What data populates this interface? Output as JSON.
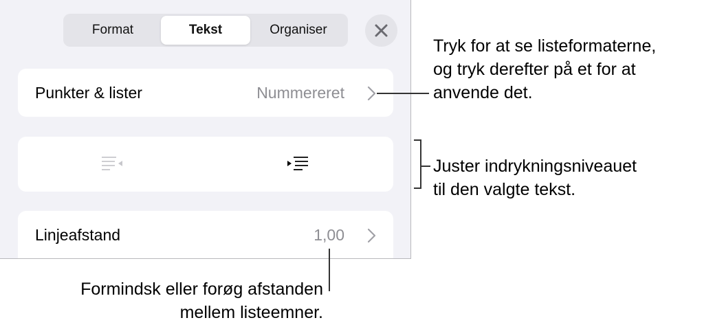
{
  "tabs": [
    {
      "label": "Format",
      "active": false
    },
    {
      "label": "Tekst",
      "active": true
    },
    {
      "label": "Organiser",
      "active": false
    }
  ],
  "close_icon": "close-icon",
  "rows": {
    "bullets": {
      "label": "Punkter & lister",
      "value": "Nummereret"
    },
    "indent": {
      "decrease_icon": "decrease-indent-icon",
      "increase_icon": "increase-indent-icon",
      "decrease_enabled": false
    },
    "spacing": {
      "label": "Linjeafstand",
      "value": "1,00"
    }
  },
  "callouts": {
    "bullets": [
      "Tryk for at se listeformaterne,",
      "og tryk derefter på et for at",
      "anvende det."
    ],
    "indent": [
      "Juster indrykningsniveauet",
      "til den valgte tekst."
    ],
    "spacing": [
      "Formindsk eller forøg afstanden",
      "mellem listeemner."
    ]
  },
  "colors": {
    "panel_bg": "#f2f2f7",
    "card_bg": "#ffffff",
    "secondary_text": "#8e8e93",
    "disabled_icon": "#c7c7cc"
  }
}
